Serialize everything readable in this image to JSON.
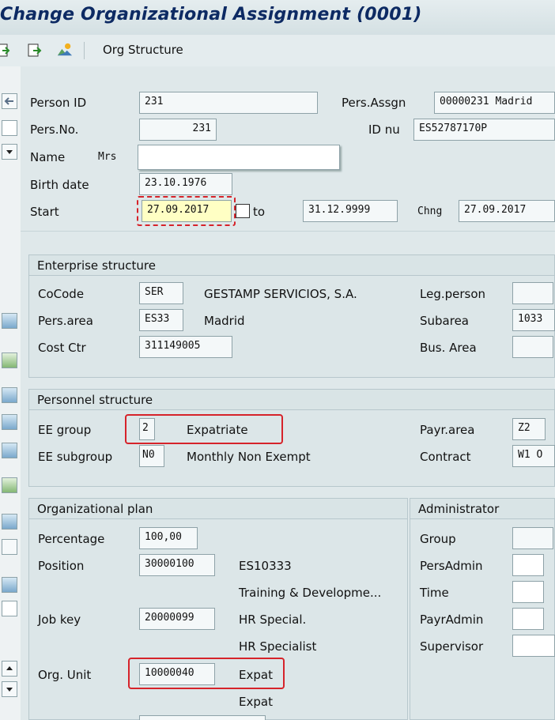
{
  "title": "Change Organizational Assignment (0001)",
  "toolbar": {
    "org_structure": "Org Structure",
    "icons": [
      "back-icon",
      "next-icon",
      "mountain-icon"
    ]
  },
  "header": {
    "person_id_label": "Person ID",
    "person_id": "231",
    "pers_assgn_label": "Pers.Assgn",
    "pers_assgn": "00000231 Madrid",
    "pers_no_label": "Pers.No.",
    "pers_no": "231",
    "id_nu_label": "ID nu",
    "id_nu": "ES52787170P",
    "name_label": "Name",
    "name_salutation": "Mrs",
    "name_value": "",
    "birth_label": "Birth date",
    "birth_date": "23.10.1976",
    "start_label": "Start",
    "start_date": "27.09.2017",
    "to_label": "to",
    "end_date": "31.12.9999",
    "chng_label": "Chng",
    "chng_date": "27.09.2017"
  },
  "enterprise": {
    "title": "Enterprise structure",
    "cocode_label": "CoCode",
    "cocode": "SER",
    "cocode_text": "GESTAMP SERVICIOS, S.A.",
    "legperson_label": "Leg.person",
    "legperson": "",
    "persarea_label": "Pers.area",
    "persarea": "ES33",
    "persarea_text": "Madrid",
    "subarea_label": "Subarea",
    "subarea": "1033",
    "costctr_label": "Cost Ctr",
    "costctr": "311149005",
    "busarea_label": "Bus. Area",
    "busarea": ""
  },
  "personnel": {
    "title": "Personnel structure",
    "eegroup_label": "EE group",
    "eegroup": "2",
    "eegroup_text": "Expatriate",
    "payrarea_label": "Payr.area",
    "payrarea": "Z2",
    "eesub_label": "EE subgroup",
    "eesub": "N0",
    "eesub_text": "Monthly Non Exempt",
    "contract_label": "Contract",
    "contract": "W1 O"
  },
  "orgplan": {
    "title": "Organizational plan",
    "percentage_label": "Percentage",
    "percentage": "100,00",
    "position_label": "Position",
    "position": "30000100",
    "position_text": "ES10333",
    "position_desc": "Training & Developme...",
    "jobkey_label": "Job key",
    "jobkey": "20000099",
    "jobkey_text": "HR Special.",
    "jobkey_desc": "HR Specialist",
    "orgunit_label": "Org. Unit",
    "orgunit": "10000040",
    "orgunit_text": "Expat",
    "orgunit_desc": "Expat"
  },
  "administrator": {
    "title": "Administrator",
    "group_label": "Group",
    "persadmin_label": "PersAdmin",
    "time_label": "Time",
    "payradmin_label": "PayrAdmin",
    "supervisor_label": "Supervisor"
  },
  "colors": {
    "title": "#0d2a63",
    "highlight": "#d6232a",
    "background": "#dfe8ea"
  }
}
